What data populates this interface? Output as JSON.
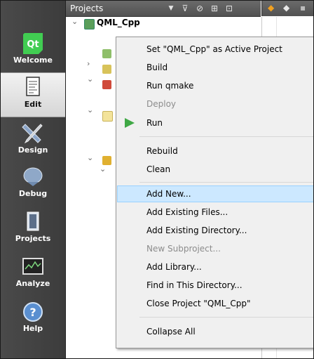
{
  "modebar": {
    "modes": [
      {
        "label": "Welcome",
        "icon": "qt-logo-icon"
      },
      {
        "label": "Edit",
        "icon": "edit-document-icon",
        "active": true
      },
      {
        "label": "Design",
        "icon": "design-pencil-icon"
      },
      {
        "label": "Debug",
        "icon": "debug-bug-icon"
      },
      {
        "label": "Projects",
        "icon": "projects-icon"
      },
      {
        "label": "Analyze",
        "icon": "analyze-monitor-icon"
      },
      {
        "label": "Help",
        "icon": "help-icon"
      }
    ]
  },
  "panel": {
    "title": "Projects",
    "project_name": "QML_Cpp"
  },
  "menu": {
    "items": [
      {
        "label": "Set \"QML_Cpp\" as Active Project",
        "enabled": true
      },
      {
        "label": "Build",
        "enabled": true
      },
      {
        "label": "Run qmake",
        "enabled": true
      },
      {
        "label": "Deploy",
        "enabled": false
      },
      {
        "label": "Run",
        "enabled": true,
        "icon": "run-triangle-icon"
      },
      {
        "label": "Rebuild",
        "enabled": true
      },
      {
        "label": "Clean",
        "enabled": true
      },
      {
        "label": "Add New...",
        "enabled": true,
        "highlighted": true
      },
      {
        "label": "Add Existing Files...",
        "enabled": true
      },
      {
        "label": "Add Existing Directory...",
        "enabled": true
      },
      {
        "label": "New Subproject...",
        "enabled": false
      },
      {
        "label": "Add Library...",
        "enabled": true
      },
      {
        "label": "Find in This Directory...",
        "enabled": true
      },
      {
        "label": "Close Project \"QML_Cpp\"",
        "enabled": true
      },
      {
        "label": "Collapse All",
        "enabled": true
      }
    ]
  },
  "colors": {
    "run_green": "#3fa845",
    "highlight": "#cce8ff",
    "modebar": "#444444"
  }
}
